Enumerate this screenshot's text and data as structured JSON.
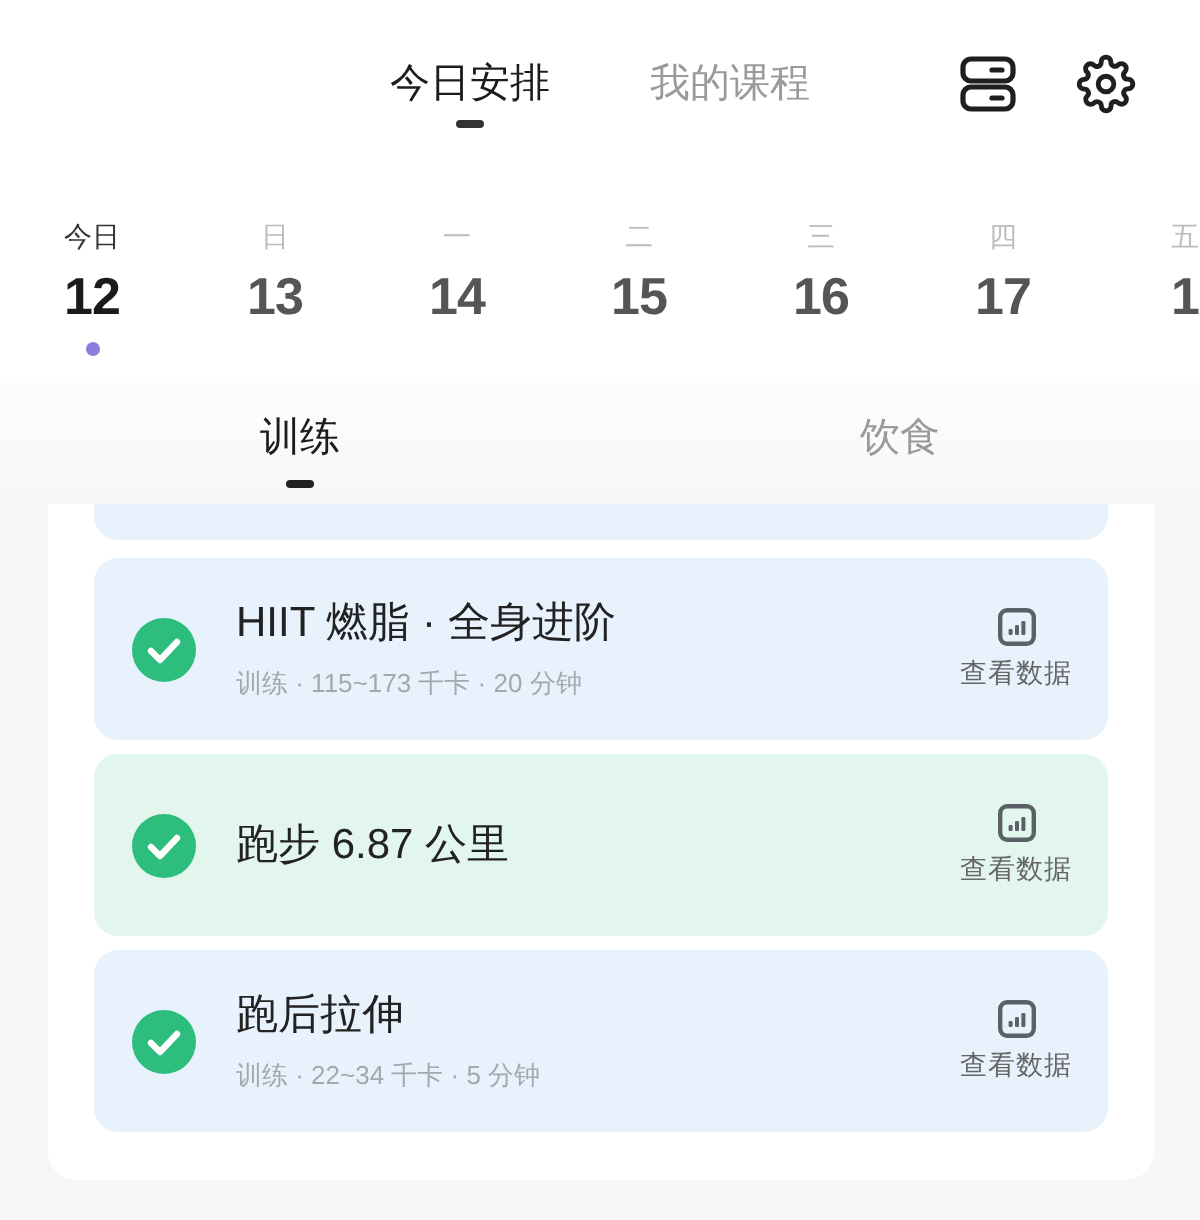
{
  "top_tabs": [
    {
      "label": "今日安排",
      "selected": true
    },
    {
      "label": "我的课程",
      "selected": false
    }
  ],
  "dates": [
    {
      "weekday": "今日",
      "day": "12",
      "selected": true
    },
    {
      "weekday": "日",
      "day": "13",
      "selected": false
    },
    {
      "weekday": "一",
      "day": "14",
      "selected": false
    },
    {
      "weekday": "二",
      "day": "15",
      "selected": false
    },
    {
      "weekday": "三",
      "day": "16",
      "selected": false
    },
    {
      "weekday": "四",
      "day": "17",
      "selected": false
    },
    {
      "weekday": "五",
      "day": "1",
      "selected": false
    }
  ],
  "sub_tabs": [
    {
      "label": "训练",
      "selected": true
    },
    {
      "label": "饮食",
      "selected": false
    }
  ],
  "activities": [
    {
      "title": "HIIT 燃脂 · 全身进阶",
      "subtitle": "训练 · 115~173 千卡 · 20 分钟",
      "done": true,
      "color": "#e8f2fd",
      "action": "查看数据"
    },
    {
      "title": "跑步 6.87 公里",
      "done": true,
      "color": "#e3f6ed",
      "action": "查看数据"
    },
    {
      "title": "跑后拉伸",
      "subtitle": "训练 · 22~34 千卡 · 5 分钟",
      "done": true,
      "color": "#e8f2fd",
      "action": "查看数据"
    }
  ]
}
